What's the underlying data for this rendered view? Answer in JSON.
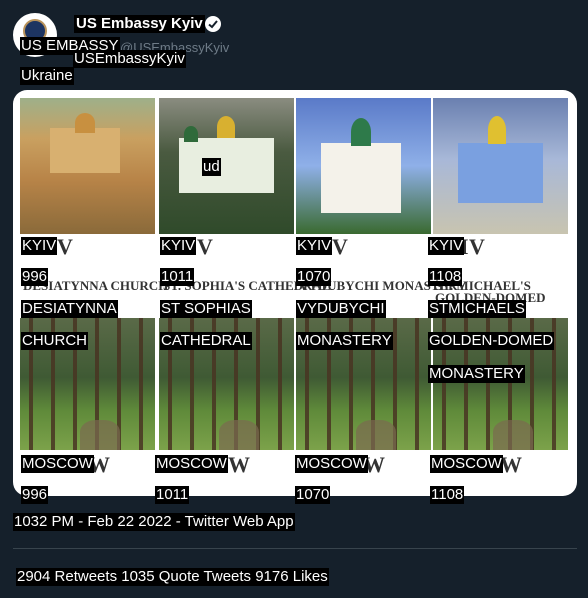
{
  "author": {
    "name": "US Embassy Kyiv",
    "avatar_label": "US EMBASSY",
    "handle": "USEmbassyKyiv",
    "location_line": "Ukraine",
    "ghost_handle": "@USEmbassyKyiv"
  },
  "overlay_text": "ud",
  "panels": [
    {
      "city": "KYIV",
      "year": "996",
      "name": [
        "DESIATYNNA",
        "CHURCH"
      ]
    },
    {
      "city": "KYIV",
      "year": "1011",
      "name": [
        "ST SOPHIAS",
        "CATHEDRAL"
      ]
    },
    {
      "city": "KYIV",
      "year": "1070",
      "name": [
        "VYDUBYCHI",
        "MONASTERY"
      ]
    },
    {
      "city": "KYIV",
      "year": "1108",
      "name": [
        "STMICHAELS",
        "GOLDEN-DOMED",
        "MONASTERY"
      ]
    }
  ],
  "printed_names": [
    "DESIATYNNA CHURCH",
    "ST. SOPHIA'S CATHEDRAL",
    "VYDUBYCHI MONASTERY",
    "ST. MICHAEL'S GOLDEN-DOMED"
  ],
  "moscow_panels": [
    {
      "city": "MOSCOW",
      "year": "996"
    },
    {
      "city": "MOSCOW",
      "year": "1011"
    },
    {
      "city": "MOSCOW",
      "year": "1070"
    },
    {
      "city": "MOSCOW",
      "year": "1108"
    }
  ],
  "tweet": {
    "timestamp": "1032 PM - Feb 22 2022 - Twitter Web App",
    "stats": "2904 Retweets 1035 Quote Tweets 9176 Likes"
  },
  "icons": [
    "verified-badge-icon",
    "embassy-seal-icon"
  ],
  "colors": {
    "background": "#15202b",
    "verified": "#ffffff",
    "divider": "#38444d"
  }
}
